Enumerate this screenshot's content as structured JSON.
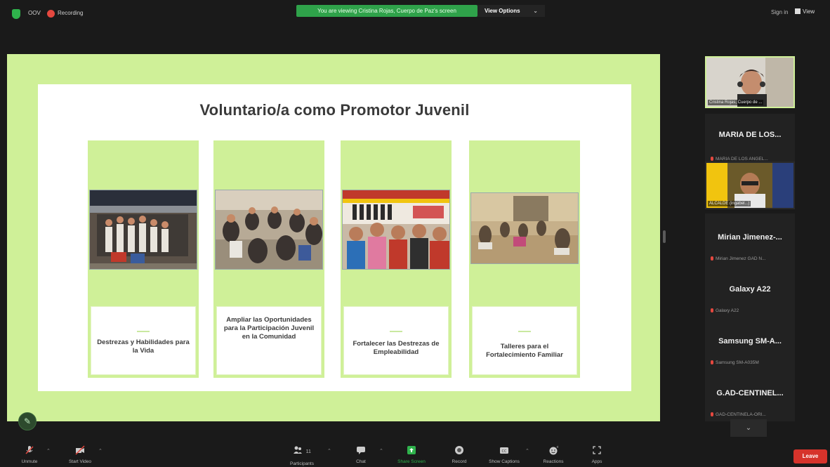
{
  "topbar": {
    "zoom_label": "OOV",
    "recording_label": "Recording",
    "viewing_banner": "You are viewing Cristina Rojas, Cuerpo de Paz's screen",
    "view_options": "View Options",
    "sign_in": "Sign in",
    "view": "View"
  },
  "slide": {
    "title": "Voluntario/a como Promotor Juvenil",
    "cards": [
      {
        "label": "Destrezas y Habilidades para la Vida"
      },
      {
        "label": "Ampliar las Oportunidades para la Participación Juvenil en la Comunidad"
      },
      {
        "label": "Fortalecer las Destrezas de Empleabilidad"
      },
      {
        "label": "Talleres para el Fortalecimiento Familiar"
      }
    ]
  },
  "participants": {
    "video_tile_1": "Cristina Rojas, Cuerpo de ...",
    "tiles": [
      {
        "name": "MARIA DE LOS...",
        "sub": "MARIA DE LOS ANGEL..."
      },
      {
        "name": "",
        "sub": "ALCALDE (ingabel...)"
      },
      {
        "name": "Mirian Jimenez-...",
        "sub": "Mirian Jimenez GAD N..."
      },
      {
        "name": "Galaxy A22",
        "sub": "Galaxy A22"
      },
      {
        "name": "Samsung SM-A...",
        "sub": "Samsung SM-A035M"
      },
      {
        "name": "G.AD-CENTINEL...",
        "sub": "GAD-CENTINELA-ORI..."
      }
    ]
  },
  "toolbar": {
    "unmute": "Unmute",
    "start_video": "Start Video",
    "participants": "Participants",
    "participants_count": "11",
    "chat": "Chat",
    "share_screen": "Share Screen",
    "record": "Record",
    "show_captions": "Show Captions",
    "reactions": "Reactions",
    "apps": "Apps",
    "leave": "Leave"
  },
  "colors": {
    "slide_green": "#cff098",
    "banner_green": "#2fa24a",
    "leave_red": "#d6332b"
  }
}
